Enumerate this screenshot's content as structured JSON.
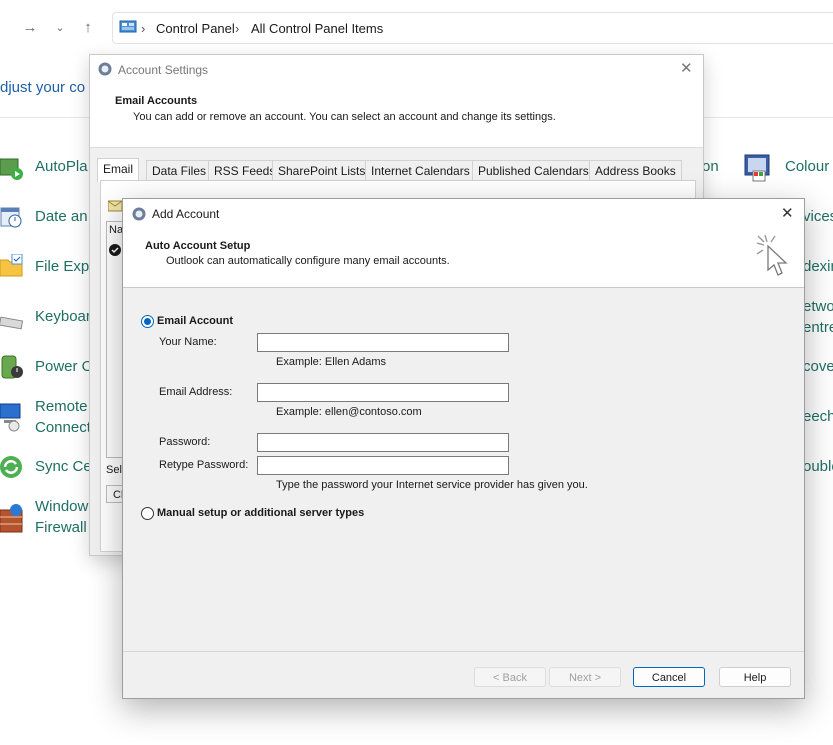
{
  "explorer": {
    "breadcrumb": [
      "Control Panel",
      "All Control Panel Items"
    ],
    "heading_partial": "djust your co",
    "items_left": [
      "AutoPla",
      "Date an",
      "File Expl",
      "Keyboar",
      "Power O",
      "Remote",
      "Connect",
      "Sync Ce",
      "Window",
      "Firewall"
    ],
    "items_mid": [
      "on"
    ],
    "items_right": [
      "Colour",
      "vices",
      "dexin",
      "etwor",
      "entre",
      "cove",
      "eech",
      "ouble"
    ]
  },
  "account_settings": {
    "title": "Account Settings",
    "header_title": "Email Accounts",
    "header_desc": "You can add or remove an account. You can select an account and change its settings.",
    "tabs": [
      "Email",
      "Data Files",
      "RSS Feeds",
      "SharePoint Lists",
      "Internet Calendars",
      "Published Calendars",
      "Address Books"
    ],
    "list_header_partial": "Na",
    "select_partial": "Sele",
    "button_partial": "Cl"
  },
  "add_account": {
    "title": "Add Account",
    "header_title": "Auto Account Setup",
    "header_desc": "Outlook can automatically configure many email accounts.",
    "email_account_label": "Email Account",
    "your_name_label": "Your Name:",
    "your_name_value": "",
    "your_name_example": "Example: Ellen Adams",
    "email_label": "Email Address:",
    "email_value": "",
    "email_example": "Example: ellen@contoso.com",
    "password_label": "Password:",
    "password_value": "",
    "retype_label": "Retype Password:",
    "retype_value": "",
    "password_hint": "Type the password your Internet service provider has given you.",
    "manual_label": "Manual setup or additional server types",
    "email_account_selected": true,
    "manual_selected": false,
    "buttons": {
      "back": "< Back",
      "next": "Next >",
      "cancel": "Cancel",
      "help": "Help"
    }
  },
  "colors": {
    "accent": "#0067c0",
    "link_teal": "#1f6f63",
    "dialog_bg": "#f0f0f0"
  }
}
